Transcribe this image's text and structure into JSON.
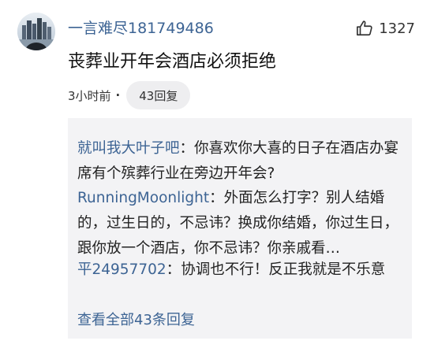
{
  "comment": {
    "username": "一言难尽181749486",
    "like_count": "1327",
    "content": "丧葬业开年会酒店必须拒绝",
    "time": "3小时前",
    "dot": "·",
    "reply_count_label": "43回复",
    "avatar_icon": "city-skyline-avatar",
    "like_icon": "thumbs-up-icon"
  },
  "replies": [
    {
      "name": "就叫我大叶子吧",
      "separator": "：",
      "text": "你喜欢你大喜的日子在酒店办宴席有个殡葬行业在旁边开年会?"
    },
    {
      "name": "RunningMoonlight",
      "separator": "：",
      "text": "外面怎么打字？别人结婚的，过生日的，不忌讳？换成你结婚，你过生日，跟你放一个酒店，你不忌讳？你亲戚看…"
    },
    {
      "name": "平24957702",
      "separator": "：",
      "text": "协调也不行！反正我就是不乐意"
    }
  ],
  "view_all_label": "查看全部43条回复",
  "colors": {
    "link_blue": "#3d6494",
    "reply_bg": "#f3f3f5",
    "pill_bg": "#eeeef0"
  }
}
